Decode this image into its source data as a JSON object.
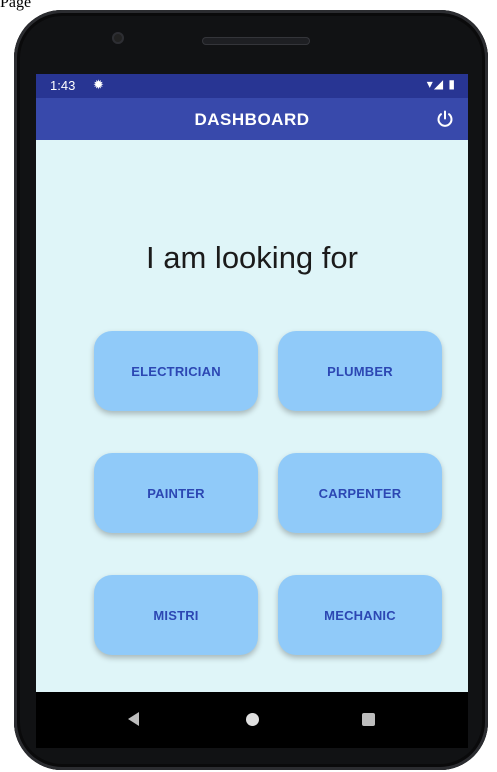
{
  "doc_label": "Page",
  "status_bar": {
    "time": "1:43",
    "settings_icon": "gear-icon",
    "right_icons": "▾◢ ▮"
  },
  "app_bar": {
    "title": "DASHBOARD",
    "power_icon": "power-icon"
  },
  "heading": "I am looking for",
  "services": [
    {
      "label": "ELECTRICIAN"
    },
    {
      "label": "PLUMBER"
    },
    {
      "label": "PAINTER"
    },
    {
      "label": "CARPENTER"
    },
    {
      "label": "MISTRI"
    },
    {
      "label": "MECHANIC"
    }
  ],
  "colors": {
    "app_bar": "#3849ab",
    "status_bar": "#283593",
    "background": "#dff5f8",
    "button": "#90caf9",
    "button_text": "#2c47b3"
  }
}
